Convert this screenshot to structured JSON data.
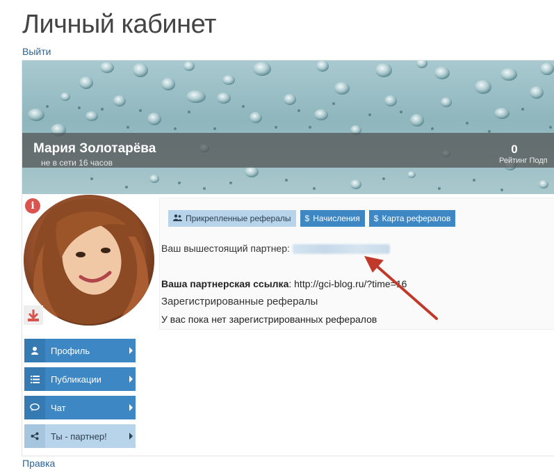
{
  "page": {
    "title": "Личный кабинет",
    "logout_label": "Выйти",
    "edit_label": "Правка"
  },
  "profile": {
    "name": "Мария Золотарёва",
    "status": "не в сети 16 часов",
    "rating_value": "0",
    "rating_label": "Рейтинг Подп"
  },
  "icons": {
    "info": "info-circle-icon",
    "download": "download-icon"
  },
  "side_menu": {
    "items": [
      {
        "label": "Профиль",
        "icon": "user-icon",
        "active": false
      },
      {
        "label": "Публикации",
        "icon": "list-icon",
        "active": false
      },
      {
        "label": "Чат",
        "icon": "chat-bubble-icon",
        "active": false
      },
      {
        "label": "Ты - партнер!",
        "icon": "share-icon",
        "active": true
      }
    ]
  },
  "tabs": [
    {
      "label": "Прикрепленные рефералы",
      "icon": "users-icon",
      "active": true
    },
    {
      "label": "Начисления",
      "icon": "dollar-icon",
      "active": false
    },
    {
      "label": "Карта рефералов",
      "icon": "dollar-icon",
      "active": false
    }
  ],
  "content": {
    "partner_label": "Ваш вышестоящий партнер:",
    "ref_link_label": "Ваша партнерская ссылка",
    "ref_link_url": ": http://gci-blog.ru/?time=16",
    "registered_title": "Зарегистрированные рефералы",
    "no_referrals": "У вас пока нет зарегистрированных рефералов"
  },
  "colors": {
    "menu_blue": "#3c87c4",
    "menu_active": "#b8d4ea",
    "link": "#2a6496",
    "annotation_arrow": "#c0392b",
    "info_red": "#d9534f"
  }
}
